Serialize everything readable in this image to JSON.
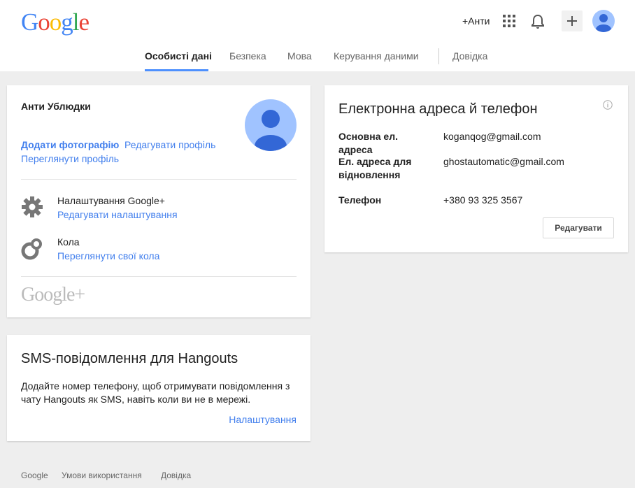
{
  "header": {
    "logo_letters": [
      {
        "ch": "G",
        "color": "#4285f4"
      },
      {
        "ch": "o",
        "color": "#ea4335"
      },
      {
        "ch": "o",
        "color": "#fbbc05"
      },
      {
        "ch": "g",
        "color": "#4285f4"
      },
      {
        "ch": "l",
        "color": "#34a853"
      },
      {
        "ch": "e",
        "color": "#ea4335"
      }
    ],
    "plus_user": "+Анти",
    "icons": [
      "apps-icon",
      "bell-icon",
      "plus-icon",
      "avatar"
    ]
  },
  "tabs": [
    {
      "label": "Особисті дані",
      "active": true
    },
    {
      "label": "Безпека",
      "active": false
    },
    {
      "label": "Мова",
      "active": false
    },
    {
      "label": "Керування даними",
      "active": false
    },
    {
      "label": "Довідка",
      "active": false
    }
  ],
  "profile": {
    "name": "Анти Ублюдки",
    "add_photo": "Додати фотографію",
    "edit_profile": "Редагувати профіль",
    "view_profile": "Переглянути профіль",
    "gplus_settings_title": "Налаштування Google+",
    "gplus_settings_link": "Редагувати налаштування",
    "circles_title": "Кола",
    "circles_link": "Переглянути свої кола",
    "gplus_logo": "Google+"
  },
  "sms": {
    "title": "SMS-повідомлення для Hangouts",
    "text": "Додайте номер телефону, щоб отримувати повідомлення з чату Hangouts як SMS, навіть коли ви не в мережі.",
    "settings_link": "Налаштування"
  },
  "contact": {
    "title": "Електронна адреса й телефон",
    "primary_label": "Основна ел. адреса",
    "primary_value": "koganqog@gmail.com",
    "recovery_label": "Ел. адреса для відновлення",
    "recovery_value": "ghostautomatic@gmail.com",
    "phone_label": "Телефон",
    "phone_value": "+380 93 325 3567",
    "edit_button": "Редагувати"
  },
  "footer": {
    "google": "Google",
    "terms": "Умови використання",
    "help": "Довідка"
  },
  "colors": {
    "link": "#427fed",
    "tab_underline": "#4d90fe",
    "avatar_bg": "#a0c3ff",
    "avatar_fg": "#3367d6"
  }
}
